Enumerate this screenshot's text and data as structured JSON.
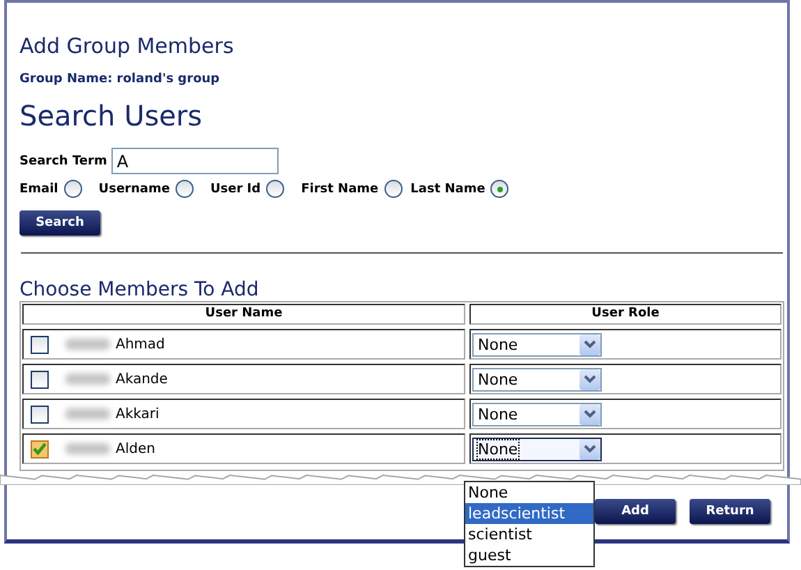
{
  "page": {
    "title": "Add Group Members",
    "group_label": "Group Name: roland's group"
  },
  "search": {
    "heading": "Search Users",
    "term_label": "Search Term",
    "term_value": "A",
    "button": "Search",
    "options": [
      {
        "label": "Email",
        "selected": false
      },
      {
        "label": "Username",
        "selected": false
      },
      {
        "label": "User Id",
        "selected": false
      },
      {
        "label": "First Name",
        "selected": false
      },
      {
        "label": "Last Name",
        "selected": true
      }
    ]
  },
  "members": {
    "heading": "Choose Members To Add",
    "columns": [
      "User Name",
      "User Role"
    ],
    "rows": [
      {
        "name": "Ahmad",
        "checked": false,
        "role": "None",
        "focused": false
      },
      {
        "name": "Akande",
        "checked": false,
        "role": "None",
        "focused": false
      },
      {
        "name": "Akkari",
        "checked": false,
        "role": "None",
        "focused": false
      },
      {
        "name": "Alden",
        "checked": true,
        "role": "None",
        "focused": true
      }
    ]
  },
  "role_dropdown": {
    "options": [
      {
        "label": "None",
        "selected": false
      },
      {
        "label": "leadscientist",
        "selected": true
      },
      {
        "label": "scientist",
        "selected": false
      },
      {
        "label": "guest",
        "selected": false
      }
    ]
  },
  "buttons": [
    "Add",
    "Return"
  ]
}
